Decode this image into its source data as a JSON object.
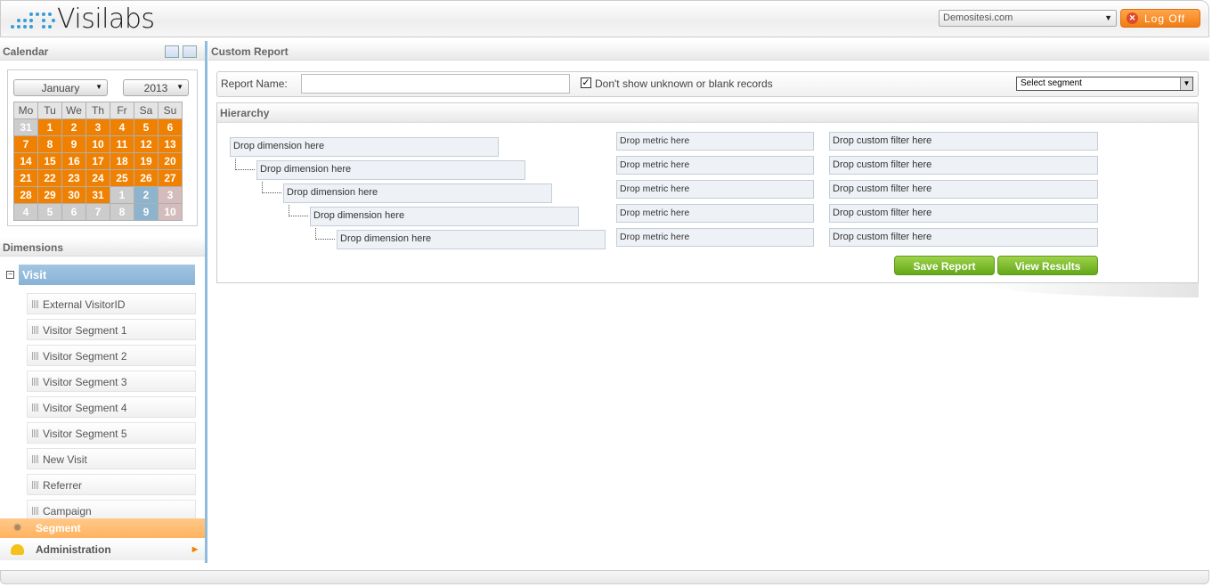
{
  "header": {
    "logo": "Visilabs",
    "site_select": "Demositesi.com",
    "logoff": "Log Off"
  },
  "sidebar": {
    "calendar": {
      "title": "Calendar",
      "month": "January",
      "year": "2013",
      "days": [
        "Mo",
        "Tu",
        "We",
        "Th",
        "Fr",
        "Sa",
        "Su"
      ],
      "weeks": [
        [
          "31",
          "1",
          "2",
          "3",
          "4",
          "5",
          "6"
        ],
        [
          "7",
          "8",
          "9",
          "10",
          "11",
          "12",
          "13"
        ],
        [
          "14",
          "15",
          "16",
          "17",
          "18",
          "19",
          "20"
        ],
        [
          "21",
          "22",
          "23",
          "24",
          "25",
          "26",
          "27"
        ],
        [
          "28",
          "29",
          "30",
          "31",
          "1",
          "2",
          "3"
        ],
        [
          "4",
          "5",
          "6",
          "7",
          "8",
          "9",
          "10"
        ]
      ]
    },
    "dimensions": {
      "title": "Dimensions",
      "group": "Visit",
      "items": [
        "External VisitorID",
        "Visitor Segment 1",
        "Visitor Segment 2",
        "Visitor Segment 3",
        "Visitor Segment 4",
        "Visitor Segment 5",
        "New Visit",
        "Referrer",
        "Campaign"
      ]
    },
    "segment": "Segment",
    "administration": "Administration"
  },
  "main": {
    "title": "Custom Report",
    "report_name_label": "Report Name:",
    "report_name_value": "",
    "dont_show_label": "Don't show unknown or blank records",
    "dont_show_checked": true,
    "segment_select": "Select segment",
    "hierarchy": {
      "title": "Hierarchy",
      "dimensions": [
        "Drop dimension here",
        "Drop dimension here",
        "Drop dimension here",
        "Drop dimension here",
        "Drop dimension here"
      ],
      "metrics": [
        "Drop metric here",
        "Drop metric here",
        "Drop metric here",
        "Drop metric here",
        "Drop metric here"
      ],
      "filters": [
        "Drop custom filter here",
        "Drop custom filter here",
        "Drop custom filter here",
        "Drop custom filter here",
        "Drop custom filter here"
      ]
    },
    "save_button": "Save Report",
    "view_button": "View Results"
  },
  "colors": {
    "accent_orange": "#f08000",
    "accent_blue": "#3c98d0",
    "button_green": "#7ab82e"
  }
}
